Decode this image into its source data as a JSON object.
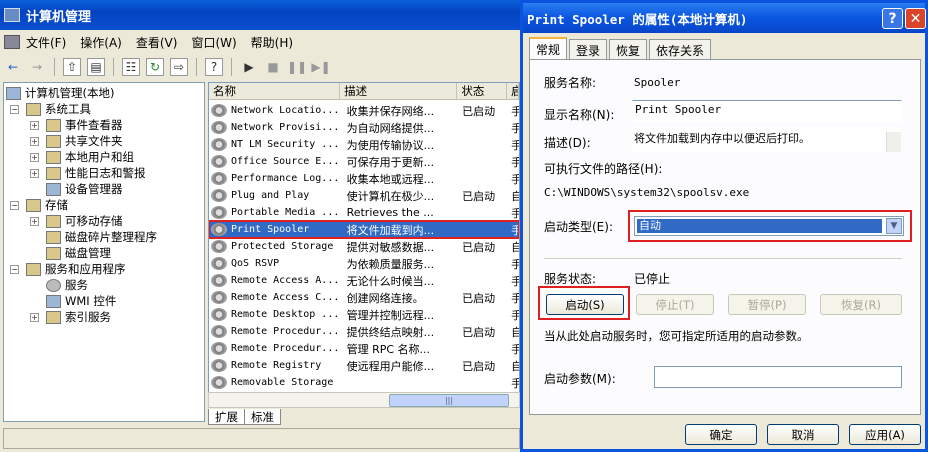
{
  "mmc": {
    "title": "计算机管理",
    "menu": [
      "文件(F)",
      "操作(A)",
      "查看(V)",
      "窗口(W)",
      "帮助(H)"
    ],
    "tree": [
      {
        "label": "计算机管理(本地)",
        "icon": "computer-icon"
      },
      {
        "label": "系统工具",
        "icon": "tools-icon"
      },
      {
        "label": "事件查看器",
        "icon": "event-viewer-icon"
      },
      {
        "label": "共享文件夹",
        "icon": "shared-folder-icon"
      },
      {
        "label": "本地用户和组",
        "icon": "users-icon"
      },
      {
        "label": "性能日志和警报",
        "icon": "performance-icon"
      },
      {
        "label": "设备管理器",
        "icon": "device-manager-icon"
      },
      {
        "label": "存储",
        "icon": "storage-icon"
      },
      {
        "label": "可移动存储",
        "icon": "removable-storage-icon"
      },
      {
        "label": "磁盘碎片整理程序",
        "icon": "defrag-icon"
      },
      {
        "label": "磁盘管理",
        "icon": "disk-icon"
      },
      {
        "label": "服务和应用程序",
        "icon": "services-apps-icon"
      },
      {
        "label": "服务",
        "icon": "services-icon"
      },
      {
        "label": "WMI 控件",
        "icon": "wmi-icon"
      },
      {
        "label": "索引服务",
        "icon": "index-icon"
      }
    ],
    "columns": [
      "名称",
      "描述",
      "状态",
      "启"
    ],
    "services": [
      {
        "name": "Network Locatio...",
        "desc": "收集并保存网络...",
        "status": "已启动",
        "start": "手"
      },
      {
        "name": "Network Provisi...",
        "desc": "为自动网络提供...",
        "status": "",
        "start": "手"
      },
      {
        "name": "NT LM Security ...",
        "desc": "为使用传输协议...",
        "status": "",
        "start": "手"
      },
      {
        "name": "Office Source E...",
        "desc": "可保存用于更新...",
        "status": "",
        "start": "手"
      },
      {
        "name": "Performance Log...",
        "desc": "收集本地或远程...",
        "status": "",
        "start": "手"
      },
      {
        "name": "Plug and Play",
        "desc": "使计算机在极少...",
        "status": "已启动",
        "start": "自"
      },
      {
        "name": "Portable Media ...",
        "desc": "Retrieves the ...",
        "status": "",
        "start": "手"
      },
      {
        "name": "Print Spooler",
        "desc": "将文件加载到内...",
        "status": "",
        "start": "手"
      },
      {
        "name": "Protected Storage",
        "desc": "提供对敏感数据...",
        "status": "已启动",
        "start": "自"
      },
      {
        "name": "QoS RSVP",
        "desc": "为依赖质量服务...",
        "status": "",
        "start": "手"
      },
      {
        "name": "Remote Access A...",
        "desc": "无论什么时候当...",
        "status": "",
        "start": "手"
      },
      {
        "name": "Remote Access C...",
        "desc": "创建网络连接。",
        "status": "已启动",
        "start": "手"
      },
      {
        "name": "Remote Desktop ...",
        "desc": "管理并控制远程...",
        "status": "",
        "start": "手"
      },
      {
        "name": "Remote Procedur...",
        "desc": "提供终结点映射...",
        "status": "已启动",
        "start": "自"
      },
      {
        "name": "Remote Procedur...",
        "desc": "管理 RPC 名称...",
        "status": "",
        "start": "手"
      },
      {
        "name": "Remote Registry",
        "desc": "使远程用户能修...",
        "status": "已启动",
        "start": "自"
      },
      {
        "name": "Removable Storage",
        "desc": "",
        "status": "",
        "start": "手"
      }
    ],
    "bottom_tabs": [
      "扩展",
      "标准"
    ]
  },
  "dialog": {
    "title": "Print Spooler 的属性(本地计算机)",
    "tabs": [
      "常规",
      "登录",
      "恢复",
      "依存关系"
    ],
    "service_name_label": "服务名称:",
    "service_name": "Spooler",
    "display_name_label": "显示名称(N):",
    "display_name": "Print Spooler",
    "description_label": "描述(D):",
    "description": "将文件加载到内存中以便迟后打印。",
    "exe_path_label": "可执行文件的路径(H):",
    "exe_path": "C:\\WINDOWS\\system32\\spoolsv.exe",
    "startup_type_label": "启动类型(E):",
    "startup_type": "自动",
    "service_status_label": "服务状态:",
    "service_status": "已停止",
    "buttons": {
      "start": "启动(S)",
      "stop": "停止(T)",
      "pause": "暂停(P)",
      "resume": "恢复(R)"
    },
    "hint": "当从此处启动服务时，您可指定所适用的启动参数。",
    "start_params_label": "启动参数(M):",
    "ok": "确定",
    "cancel": "取消",
    "apply": "应用(A)"
  }
}
